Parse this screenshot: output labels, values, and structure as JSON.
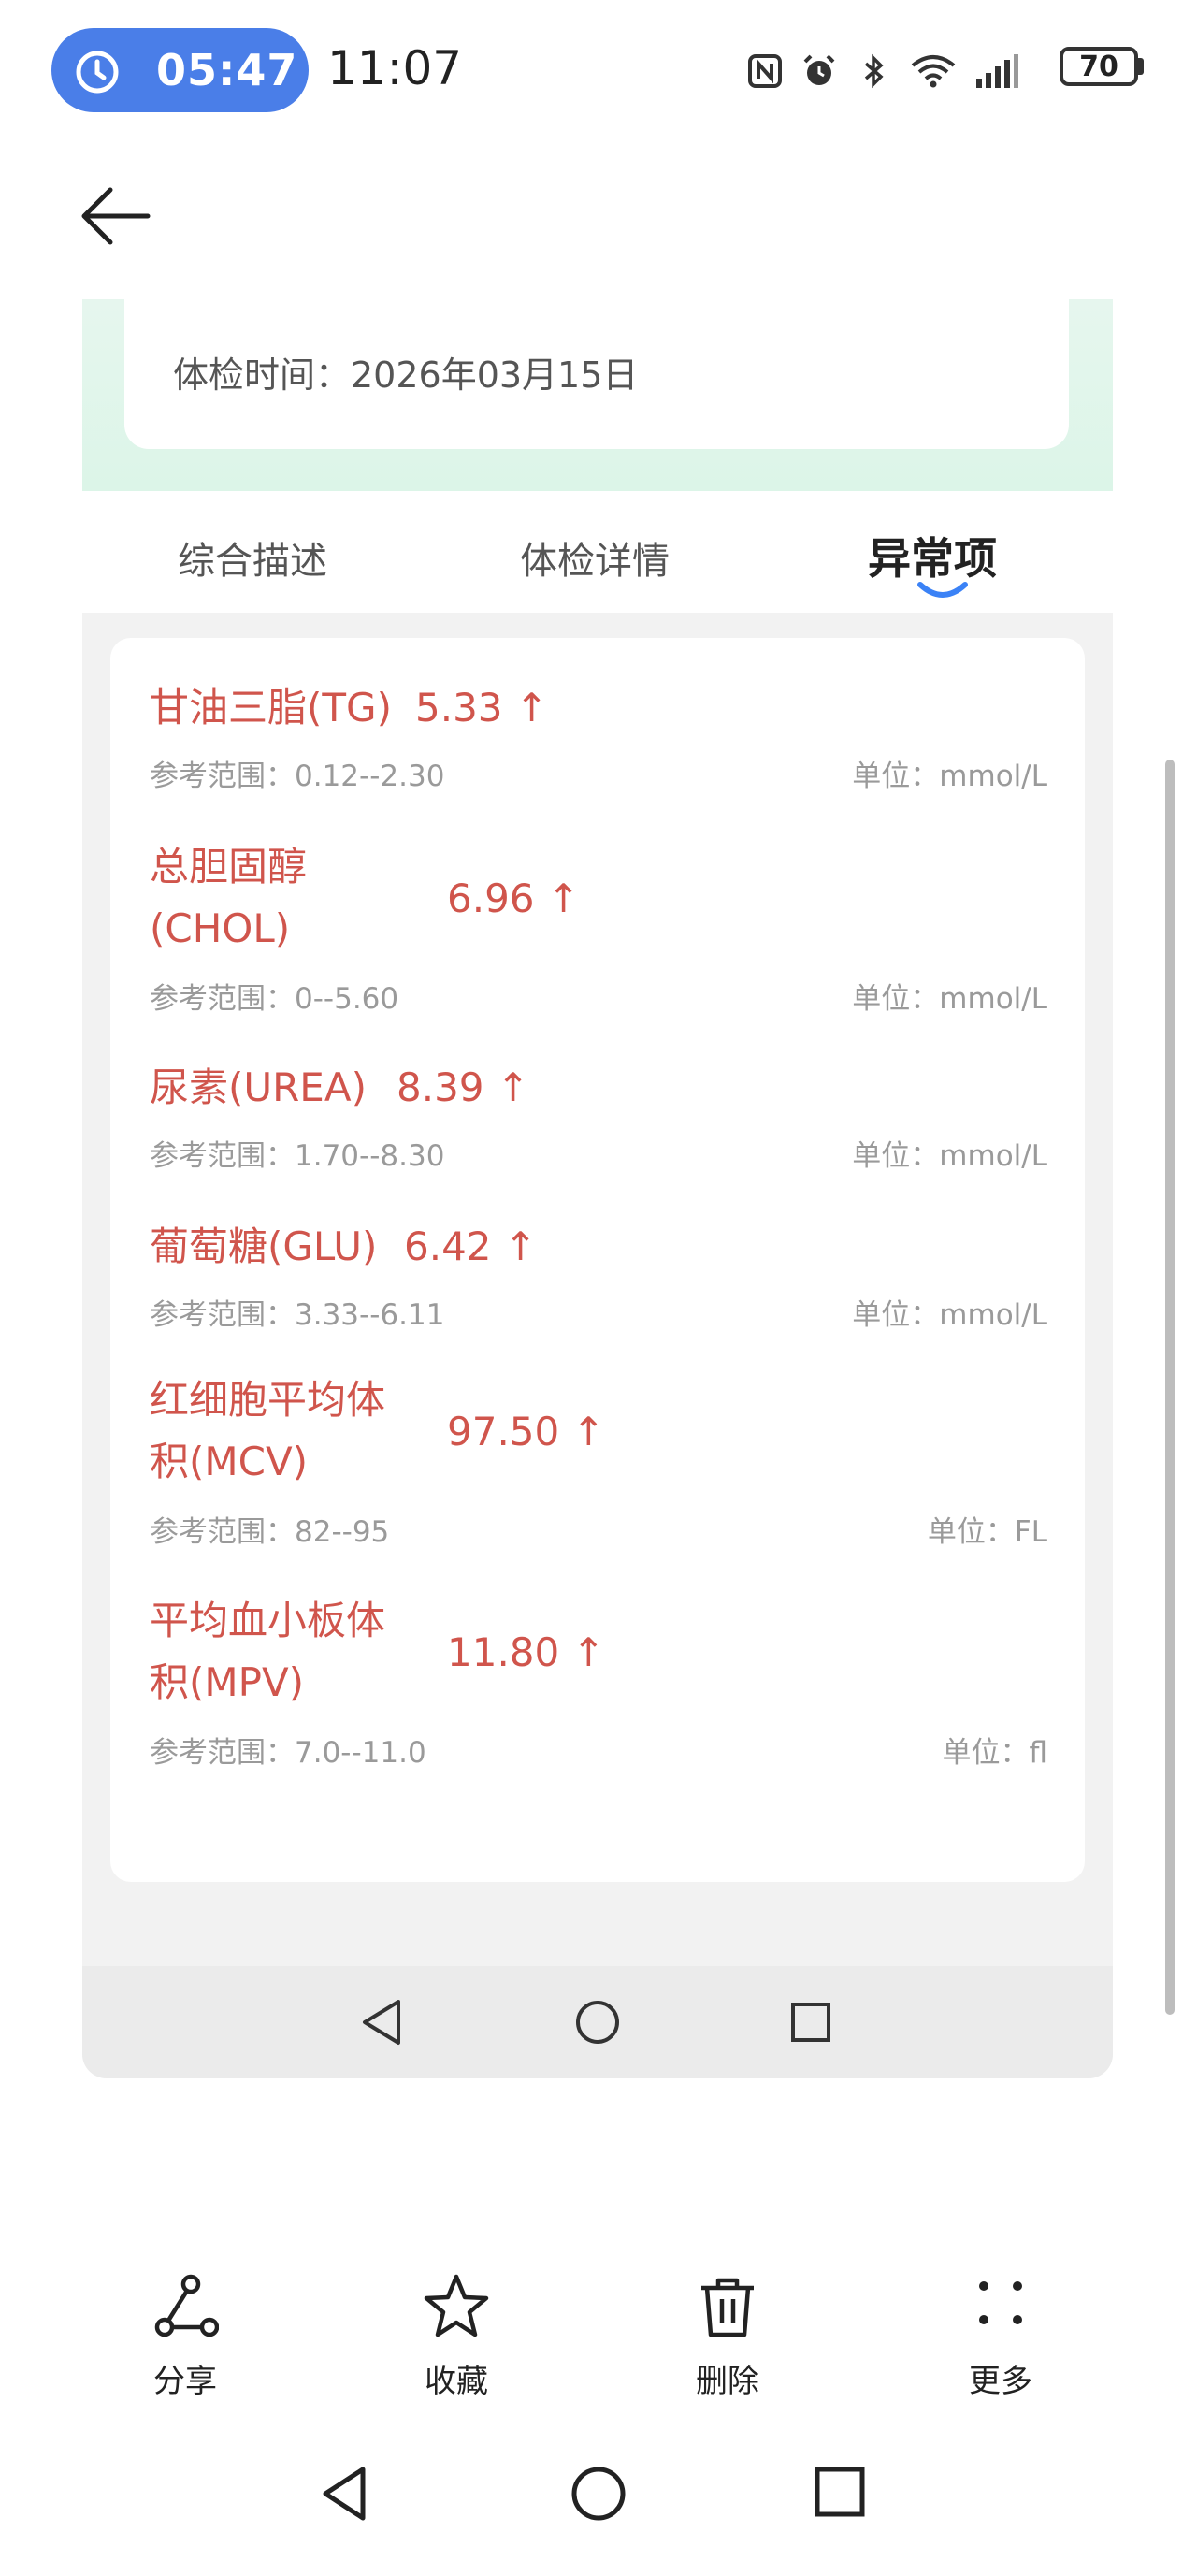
{
  "status_bar": {
    "timer": "05:47",
    "clock": "11:07",
    "battery": "70"
  },
  "report": {
    "exam_time": "体检时间：2026年03月15日"
  },
  "tabs": [
    {
      "label": "综合描述",
      "active": false
    },
    {
      "label": "体检详情",
      "active": false
    },
    {
      "label": "异常项",
      "active": true
    }
  ],
  "abnormal_items": [
    {
      "name": "甘油三脂(TG)",
      "value": "5.33 ↑",
      "range": "参考范围：0.12--2.30",
      "unit": "单位：mmol/L"
    },
    {
      "name": "总胆固醇",
      "name2": "(CHOL)",
      "value": "6.96 ↑",
      "range": "参考范围：0--5.60",
      "unit": "单位：mmol/L"
    },
    {
      "name": "尿素(UREA)",
      "value": "8.39 ↑",
      "range": "参考范围：1.70--8.30",
      "unit": "单位：mmol/L"
    },
    {
      "name": "葡萄糖(GLU)",
      "value": "6.42 ↑",
      "range": "参考范围：3.33--6.11",
      "unit": "单位：mmol/L"
    },
    {
      "name": "红细胞平均体",
      "name2": "积(MCV)",
      "value": "97.50 ↑",
      "range": "参考范围：82--95",
      "unit": "单位：FL"
    },
    {
      "name": "平均血小板体",
      "name2": "积(MPV)",
      "value": "11.80 ↑",
      "range": "参考范围：7.0--11.0",
      "unit": "单位：fl"
    }
  ],
  "toolbar": {
    "share": "分享",
    "favorite": "收藏",
    "delete": "删除",
    "more": "更多"
  },
  "colors": {
    "accent": "#4a7ee8",
    "abnormal_red": "#d0554c",
    "tab_indicator": "#3b82f6"
  }
}
